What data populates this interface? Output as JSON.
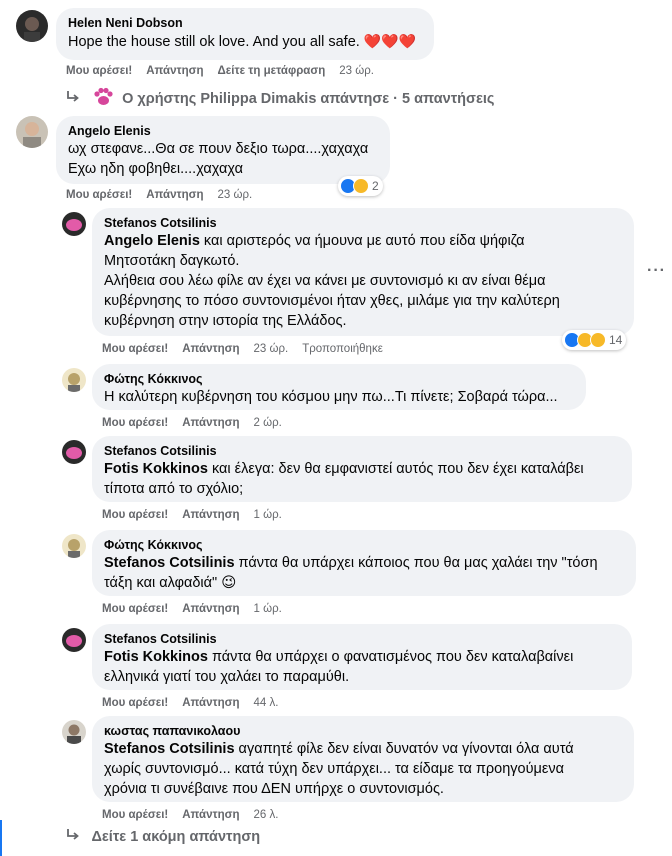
{
  "comments": [
    {
      "author": "Helen Neni Dobson",
      "text": "Hope the house still ok love. And you all safe.",
      "emoji": "❤️❤️❤️",
      "like": "Μου αρέσει!",
      "reply": "Απάντηση",
      "translate": "Δείτε τη μετάφραση",
      "time": "23 ώρ."
    },
    {
      "author": "Angelo Elenis",
      "text_lines": [
        "ωχ στεφανε...Θα σε πουν δεξιο τωρα....χαχαχα",
        "Εχω ηδη φοβηθει....χαχαχα"
      ],
      "like": "Μου αρέσει!",
      "reply": "Απάντηση",
      "time": "23 ώρ.",
      "reactions": "2"
    }
  ],
  "replies_summary": {
    "text": "Ο χρήστης Philippa Dimakis απάντησε · 5 απαντήσεις"
  },
  "replies": [
    {
      "author": "Stefanos Cotsilinis",
      "tag": "Angelo Elenis",
      "text_a": " και αριστερός να ήμουνα με αυτό που είδα ψήφιζα",
      "text_b": "Μητσοτάκη δαγκωτό.",
      "text_c": "Αλήθεια σου λέω φίλε αν έχει να κάνει με συντονισμό κι αν είναι θέμα",
      "text_d": "κυβέρνησης το πόσο συντονισμένοι ήταν χθες, μιλάμε για την καλύτερη",
      "text_e": "κυβέρνηση στην ιστορία της Ελλάδος.",
      "like": "Μου αρέσει!",
      "reply": "Απάντηση",
      "time": "23 ώρ.",
      "edited": "Τροποποιήθηκε",
      "reactions": "14"
    },
    {
      "author": "Φώτης Κόκκινος",
      "text": "Η καλύτερη κυβέρνηση του κόσμου μην πω...Τι πίνετε; Σοβαρά τώρα...",
      "like": "Μου αρέσει!",
      "reply": "Απάντηση",
      "time": "2 ώρ."
    },
    {
      "author": "Stefanos Cotsilinis",
      "tag": "Fotis Kokkinos",
      "text_a": " και έλεγα: δεν θα εμφανιστεί αυτός που δεν έχει καταλάβει",
      "text_b": "τίποτα από το σχόλιο;",
      "like": "Μου αρέσει!",
      "reply": "Απάντηση",
      "time": "1 ώρ."
    },
    {
      "author": "Φώτης Κόκκινος",
      "tag": "Stefanos Cotsilinis",
      "text_a": " πάντα θα υπάρχει κάποιος που θα μας χαλάει την \"τόση",
      "text_b": "τάξη και αλφαδιά\"",
      "emoji": "😉",
      "like": "Μου αρέσει!",
      "reply": "Απάντηση",
      "time": "1 ώρ."
    },
    {
      "author": "Stefanos Cotsilinis",
      "tag": "Fotis Kokkinos",
      "text_a": " πάντα θα υπάρχει ο φανατισμένος που δεν καταλαβαίνει",
      "text_b": "ελληνικά γιατί του χαλάει το παραμύθι.",
      "like": "Μου αρέσει!",
      "reply": "Απάντηση",
      "time": "44 λ."
    },
    {
      "author": "κωστας παπανικολαου",
      "tag": "Stefanos Cotsilinis",
      "text_a": " αγαπητέ φίλε δεν είναι δυνατόν να γίνονται όλα αυτά",
      "text_b": "χωρίς συντονισμό... κατά τύχη δεν υπάρχει... τα είδαμε τα προηγούμενα",
      "text_c": "χρόνια τι συνέβαινε που ΔΕΝ υπήρχε ο συντονισμός.",
      "like": "Μου αρέσει!",
      "reply": "Απάντηση",
      "time": "26 λ."
    }
  ],
  "more_replies": "Δείτε 1 ακόμη απάντηση",
  "colors": {
    "bubble": "#f0f2f5",
    "meta": "#65676b",
    "accent": "#1877f2"
  }
}
